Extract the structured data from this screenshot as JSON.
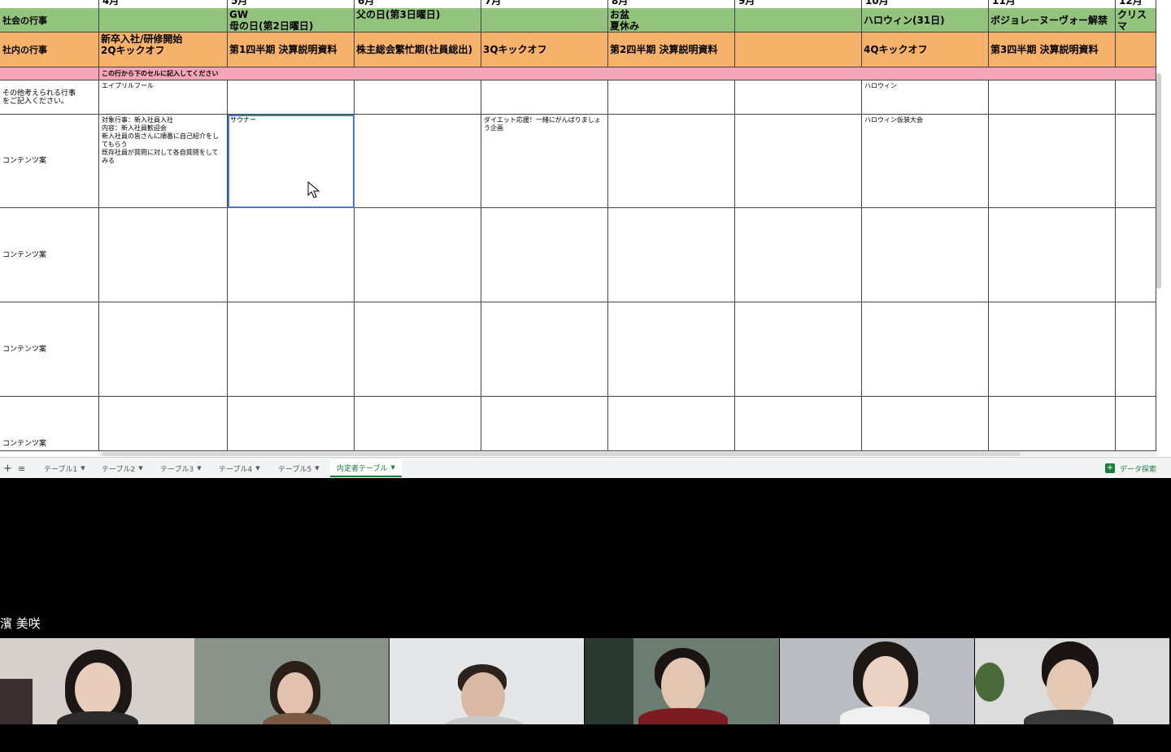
{
  "sheet": {
    "months": [
      "4月",
      "5月",
      "6月",
      "7月",
      "8月",
      "9月",
      "10月",
      "11月",
      "12月"
    ],
    "society_events_header": "社会の行事",
    "company_events_header": "社内の行事",
    "society_events": [
      "",
      "GW\n母の日(第2日曜日)",
      "父の日(第3日曜日)",
      "",
      "お盆\n夏休み",
      "",
      "ハロウィン(31日)",
      "ボジョレーヌーヴォー解禁",
      "クリスマ\n大晦日"
    ],
    "company_events": [
      "新卒入社/研修開始\n2Qキックオフ",
      "第1四半期 決算説明資料",
      "株主総会繁忙期(社員総出)",
      "3Qキックオフ",
      "第2四半期 決算説明資料",
      "",
      "4Qキックオフ",
      "第3四半期 決算説明資料",
      ""
    ],
    "instruction_row": "この行から下のセルに記入してください",
    "other_events_label": "その他考えられる行事\nをご記入ください。",
    "other_events": [
      "エイプリルフール",
      "",
      "",
      "",
      "",
      "",
      "ハロウィン",
      "",
      ""
    ],
    "content_label": "コンテンツ案",
    "content_row1": [
      "対象行事：新入社員入社\n内容：新入社員歓迎会\n新入社員の皆さんに順番に自己紹介をしてもらう\n既存社員が質問に対して各自質問をしてみる",
      "サウナー",
      "",
      "ダイエット応援！一緒にがんばりましょう企画",
      "",
      "",
      "ハロウィン仮装大会",
      "",
      ""
    ]
  },
  "tabs": {
    "add_icon": "plus-icon",
    "list_icon": "menu-icon",
    "items": [
      "テーブル1",
      "テーブル2",
      "テーブル3",
      "テーブル4",
      "テーブル5",
      "内定者テーブル"
    ],
    "active_index": 5,
    "explore_label": "データ探索"
  },
  "meeting": {
    "speaker_name": "濱 美咲",
    "participants": 6
  },
  "colors": {
    "green": "#93c47d",
    "orange": "#f6b26b",
    "pink": "#f4a6b8",
    "selection": "#4a78c8",
    "active_tab": "#188038"
  }
}
